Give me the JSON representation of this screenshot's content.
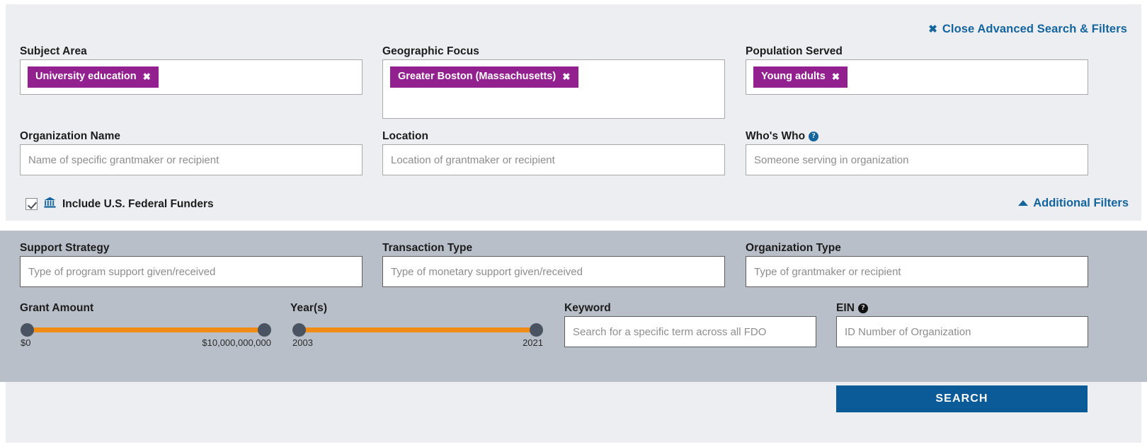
{
  "header": {
    "close_icon": "close-x-icon",
    "close_label": "Close Advanced Search & Filters"
  },
  "colors": {
    "chip": "#93208f",
    "link": "#14649e",
    "slider_track": "#f08c15",
    "slider_knob": "#4a5361",
    "search_button": "#0a5b98",
    "panel_top": "#eceef1",
    "panel_mid": "#b9bfc8"
  },
  "primary_filters": {
    "subject_area": {
      "label": "Subject Area",
      "chips": [
        {
          "text": "University education",
          "remove_icon": "remove-x-icon"
        }
      ]
    },
    "geographic_focus": {
      "label": "Geographic Focus",
      "chips": [
        {
          "text": "Greater Boston (Massachusetts)",
          "remove_icon": "remove-x-icon"
        }
      ]
    },
    "population_served": {
      "label": "Population Served",
      "chips": [
        {
          "text": "Young adults",
          "remove_icon": "remove-x-icon"
        }
      ]
    },
    "organization_name": {
      "label": "Organization Name",
      "value": "",
      "placeholder": "Name of specific grantmaker or recipient"
    },
    "location": {
      "label": "Location",
      "value": "",
      "placeholder": "Location of grantmaker or recipient"
    },
    "whos_who": {
      "label": "Who's Who",
      "help_icon": "help-question-icon",
      "help_glyph": "?",
      "value": "",
      "placeholder": "Someone serving in organization"
    }
  },
  "federal_funders": {
    "checked": true,
    "icon": "bank-institution-icon",
    "label": "Include U.S. Federal Funders"
  },
  "additional_filters_toggle": {
    "icon": "caret-up-icon",
    "label": "Additional Filters"
  },
  "additional_filters": {
    "support_strategy": {
      "label": "Support Strategy",
      "value": "",
      "placeholder": "Type of program support given/received"
    },
    "transaction_type": {
      "label": "Transaction Type",
      "value": "",
      "placeholder": "Type of monetary support given/received"
    },
    "organization_type": {
      "label": "Organization Type",
      "value": "",
      "placeholder": "Type of grantmaker or recipient"
    },
    "grant_amount": {
      "label": "Grant Amount",
      "min_label": "$0",
      "max_label": "$10,000,000,000",
      "min_value": 0,
      "max_value": 10000000000
    },
    "years": {
      "label": "Year(s)",
      "min_label": "2003",
      "max_label": "2021",
      "min_value": 2003,
      "max_value": 2021
    },
    "keyword": {
      "label": "Keyword",
      "value": "",
      "placeholder": "Search for a specific term across all FDO"
    },
    "ein": {
      "label": "EIN",
      "help_icon": "help-question-icon",
      "help_glyph": "?",
      "value": "",
      "placeholder": "ID Number of Organization"
    }
  },
  "actions": {
    "search_label": "SEARCH"
  }
}
